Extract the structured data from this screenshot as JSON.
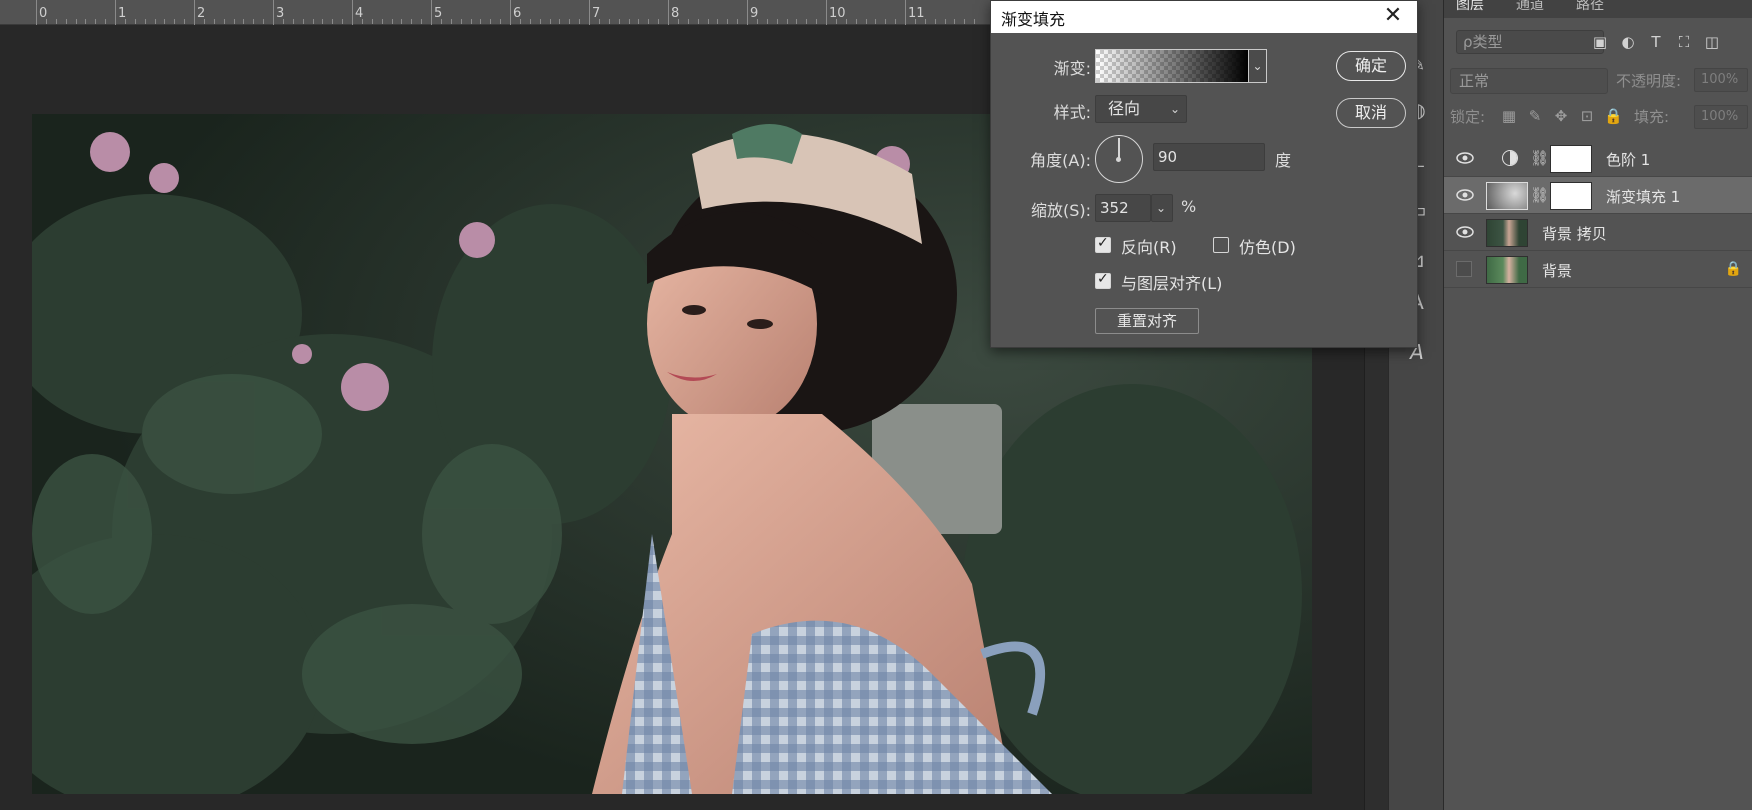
{
  "ruler": {
    "numbers": [
      "0",
      "1",
      "2",
      "3",
      "4",
      "5",
      "6",
      "7",
      "8",
      "9",
      "10",
      "11"
    ]
  },
  "dialog": {
    "title": "渐变填充",
    "gradient_label": "渐变:",
    "style_label": "样式:",
    "style_value": "径向",
    "angle_label": "角度(A):",
    "angle_value": "90",
    "angle_unit": "度",
    "scale_label": "缩放(S):",
    "scale_value": "352",
    "scale_unit": "%",
    "reverse_label": "反向(R)",
    "reverse_checked": true,
    "dither_label": "仿色(D)",
    "dither_checked": false,
    "align_label": "与图层对齐(L)",
    "align_checked": true,
    "reset_align_label": "重置对齐",
    "ok_label": "确定",
    "cancel_label": "取消",
    "close_glyph": "✕"
  },
  "layers_panel": {
    "tabs": [
      "图层",
      "通道",
      "路径"
    ],
    "filter_placeholder": "ρ类型",
    "blend_mode": "正常",
    "opacity_label": "不透明度:",
    "opacity_value": "100%",
    "lock_label": "锁定:",
    "fill_label": "填充:",
    "fill_value": "100%",
    "layers": [
      {
        "name": "色阶 1",
        "visible": true,
        "selected": false,
        "kind": "adjustment"
      },
      {
        "name": "渐变填充 1",
        "visible": true,
        "selected": true,
        "kind": "gradient-fill"
      },
      {
        "name": "背景 拷贝",
        "visible": true,
        "selected": false,
        "kind": "photo"
      },
      {
        "name": "背景",
        "visible": false,
        "selected": false,
        "kind": "photo-locked"
      }
    ]
  },
  "colors": {
    "panel_bg": "#535353",
    "selected_layer": "#6b6b6b",
    "canvas_bg": "#282828"
  }
}
